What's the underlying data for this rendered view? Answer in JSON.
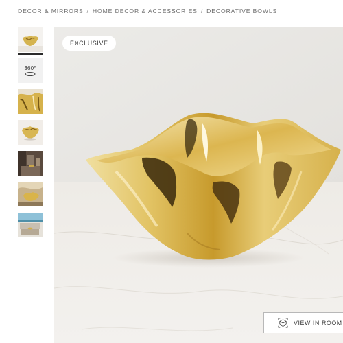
{
  "breadcrumb": {
    "items": [
      "DECOR & MIRRORS",
      "HOME DECOR & ACCESSORIES",
      "DECORATIVE BOWLS"
    ],
    "separator": "/"
  },
  "gallery": {
    "thumbnail_360_label": "360°",
    "badge": "EXCLUSIVE",
    "view_in_room_label": "VIEW IN ROOM"
  },
  "colors": {
    "gold": "#d9b955",
    "marble": "#ede9e4",
    "active_indicator": "#2b2b2b"
  }
}
